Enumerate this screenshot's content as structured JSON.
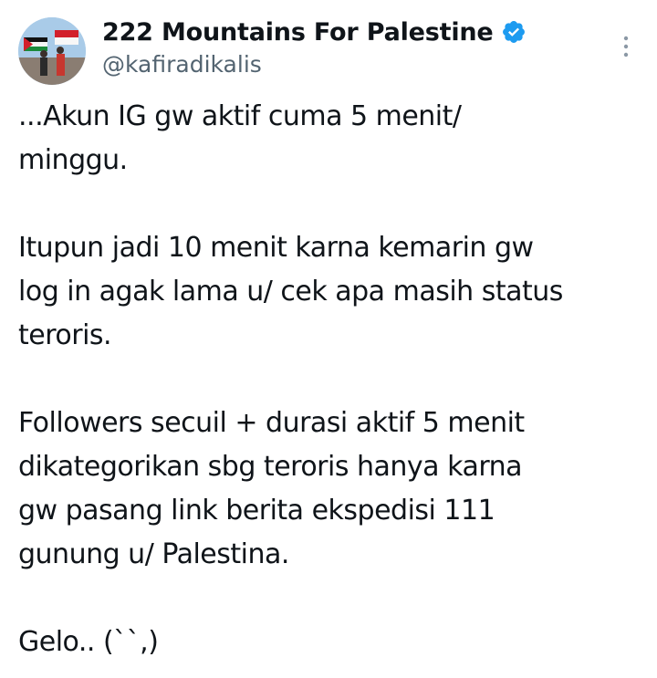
{
  "author": {
    "display_name": "222 Mountains For Palestine",
    "handle": "@kafiradikalis",
    "verified": true,
    "verified_color": "#1d9bf0",
    "avatar_icon": "profile-photo-with-flags",
    "more_icon": "vertical-ellipsis"
  },
  "tweet": {
    "paragraphs": [
      "...Akun IG gw aktif cuma 5 menit/\nminggu.",
      "Itupun jadi 10 menit karna kemarin gw\nlog in agak lama u/ cek apa masih status\nteroris.",
      "Followers secuil + durasi aktif 5 menit\ndikategorikan sbg teroris hanya karna\ngw pasang link berita ekspedisi 111\ngunung u/ Palestina.",
      "Gelo.. (``,)"
    ]
  },
  "colors": {
    "text_primary": "#0f1419",
    "text_secondary": "#536471",
    "background": "#ffffff"
  }
}
